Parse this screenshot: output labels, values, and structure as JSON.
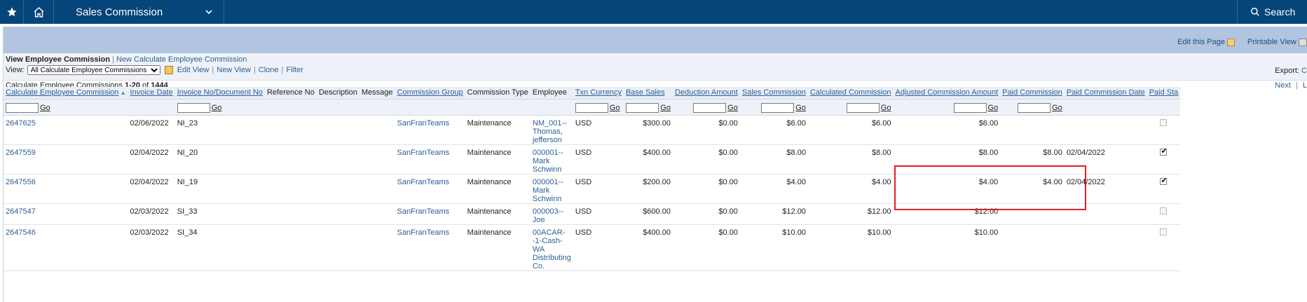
{
  "topbar": {
    "module": "Sales Commission",
    "search_label": "Search"
  },
  "header_links": {
    "edit_page": "Edit this Page",
    "printable_view": "Printable View"
  },
  "breadcrumb": {
    "current": "View Employee Commission",
    "separator": "|",
    "new_link": "New Calculate Employee Commission"
  },
  "view": {
    "label": "View:",
    "selected": "All Calculate Employee Commissions",
    "links": [
      "Edit View",
      "New View",
      "Clone",
      "Filter"
    ]
  },
  "export_label": "Export:",
  "export_link": "C",
  "count": {
    "prefix": "Calculate Employee Commissions ",
    "range": "1-20",
    "of": " of ",
    "total": "1444"
  },
  "pager": {
    "next": "Next",
    "last": "L"
  },
  "columns": [
    {
      "label": "Calculate Employee Commission",
      "sortable": true,
      "sorted": "asc"
    },
    {
      "label": "Invoice Date",
      "sortable": true
    },
    {
      "label": "Invoice No/Document No",
      "sortable": true
    },
    {
      "label": "Reference No",
      "sortable": false
    },
    {
      "label": "Description",
      "sortable": false
    },
    {
      "label": "Message",
      "sortable": false
    },
    {
      "label": "Commission Group",
      "sortable": true
    },
    {
      "label": "Commission Type",
      "sortable": false
    },
    {
      "label": "Employee",
      "sortable": false
    },
    {
      "label": "Txn Currency",
      "sortable": true
    },
    {
      "label": "Base Sales",
      "sortable": true
    },
    {
      "label": "Deduction Amount",
      "sortable": true
    },
    {
      "label": "Sales Commission",
      "sortable": true
    },
    {
      "label": "Calculated Commission",
      "sortable": true
    },
    {
      "label": "Adjusted Commission Amount",
      "sortable": true
    },
    {
      "label": "Paid Commission",
      "sortable": true
    },
    {
      "label": "Paid Commission Date",
      "sortable": true
    },
    {
      "label": "Paid Sta",
      "sortable": true
    }
  ],
  "go_label": "Go",
  "rows": [
    {
      "id": "2647625",
      "invoice_date": "02/06/2022",
      "invoice_no": "NI_23",
      "group": "SanFranTeams",
      "type": "Maintenance",
      "employee": [
        "NM_001--",
        "Thomas,",
        "jefferson"
      ],
      "currency": "USD",
      "base": "$300.00",
      "deduction": "$0.00",
      "sales_comm": "$6.00",
      "calc_comm": "$6.00",
      "adj_comm": "$6.00",
      "paid_comm": "",
      "paid_date": "",
      "paid_status": false
    },
    {
      "id": "2647559",
      "invoice_date": "02/04/2022",
      "invoice_no": "NI_20",
      "group": "SanFranTeams",
      "type": "Maintenance",
      "employee": [
        "000001--",
        "Mark",
        "Schwinn"
      ],
      "currency": "USD",
      "base": "$400.00",
      "deduction": "$0.00",
      "sales_comm": "$8.00",
      "calc_comm": "$8.00",
      "adj_comm": "$8.00",
      "paid_comm": "$8.00",
      "paid_date": "02/04/2022",
      "paid_status": true
    },
    {
      "id": "2647556",
      "invoice_date": "02/04/2022",
      "invoice_no": "NI_19",
      "group": "SanFranTeams",
      "type": "Maintenance",
      "employee": [
        "000001--",
        "Mark",
        "Schwinn"
      ],
      "currency": "USD",
      "base": "$200.00",
      "deduction": "$0.00",
      "sales_comm": "$4.00",
      "calc_comm": "$4.00",
      "adj_comm": "$4.00",
      "paid_comm": "$4.00",
      "paid_date": "02/04/2022",
      "paid_status": true
    },
    {
      "id": "2647547",
      "invoice_date": "02/03/2022",
      "invoice_no": "SI_33",
      "group": "SanFranTeams",
      "type": "Maintenance",
      "employee": [
        "000003--",
        "Joe"
      ],
      "currency": "USD",
      "base": "$600.00",
      "deduction": "$0.00",
      "sales_comm": "$12.00",
      "calc_comm": "$12.00",
      "adj_comm": "$12.00",
      "paid_comm": "",
      "paid_date": "",
      "paid_status": false
    },
    {
      "id": "2647546",
      "invoice_date": "02/03/2022",
      "invoice_no": "SI_34",
      "group": "SanFranTeams",
      "type": "Maintenance",
      "employee": [
        "00ACAR-",
        "-1-Cash-",
        "WA",
        "Distributing",
        "Co."
      ],
      "currency": "USD",
      "base": "$400.00",
      "deduction": "$0.00",
      "sales_comm": "$10.00",
      "calc_comm": "$10.00",
      "adj_comm": "$10.00",
      "paid_comm": "",
      "paid_date": "",
      "paid_status": false
    }
  ]
}
